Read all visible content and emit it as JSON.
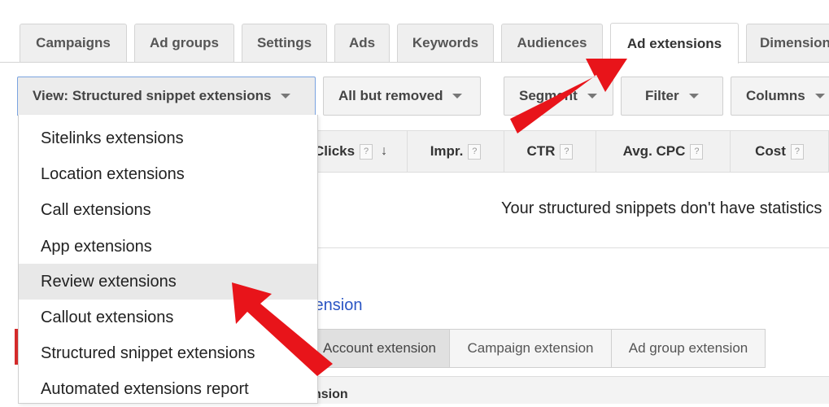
{
  "tabs": [
    {
      "label": "Campaigns",
      "active": false
    },
    {
      "label": "Ad groups",
      "active": false
    },
    {
      "label": "Settings",
      "active": false
    },
    {
      "label": "Ads",
      "active": false
    },
    {
      "label": "Keywords",
      "active": false
    },
    {
      "label": "Audiences",
      "active": false
    },
    {
      "label": "Ad extensions",
      "active": true
    },
    {
      "label": "Dimensions",
      "active": false
    }
  ],
  "toolbar": {
    "view_label": "View: Structured snippet extensions",
    "status_filter": "All but removed",
    "segment": "Segment",
    "filter": "Filter",
    "columns": "Columns"
  },
  "view_menu": {
    "items": [
      {
        "label": "Sitelinks extensions",
        "highlighted": false
      },
      {
        "label": "Location extensions",
        "highlighted": false
      },
      {
        "label": "Call extensions",
        "highlighted": false
      },
      {
        "label": "App extensions",
        "highlighted": false
      },
      {
        "label": "Review extensions",
        "highlighted": true
      },
      {
        "label": "Callout extensions",
        "highlighted": false
      },
      {
        "label": "Structured snippet extensions",
        "highlighted": false
      },
      {
        "label": "Automated extensions report",
        "highlighted": false
      }
    ]
  },
  "table": {
    "columns": [
      {
        "label": "Clicks",
        "help": "?",
        "sort": "↓"
      },
      {
        "label": "Impr.",
        "help": "?"
      },
      {
        "label": "CTR",
        "help": "?"
      },
      {
        "label": "Avg. CPC",
        "help": "?"
      },
      {
        "label": "Cost",
        "help": "?"
      }
    ],
    "empty_message": "Your structured snippets don't have statistics"
  },
  "extension_section": {
    "link_text": "tension",
    "levels": [
      "Account extension",
      "Campaign extension",
      "Ad group extension"
    ],
    "selected_level": "Account extension",
    "bottom_header": "nsion"
  },
  "colors": {
    "annotation_arrow": "#e8141a",
    "link": "#2a55c4",
    "view_button_border": "#7aa3e0"
  }
}
